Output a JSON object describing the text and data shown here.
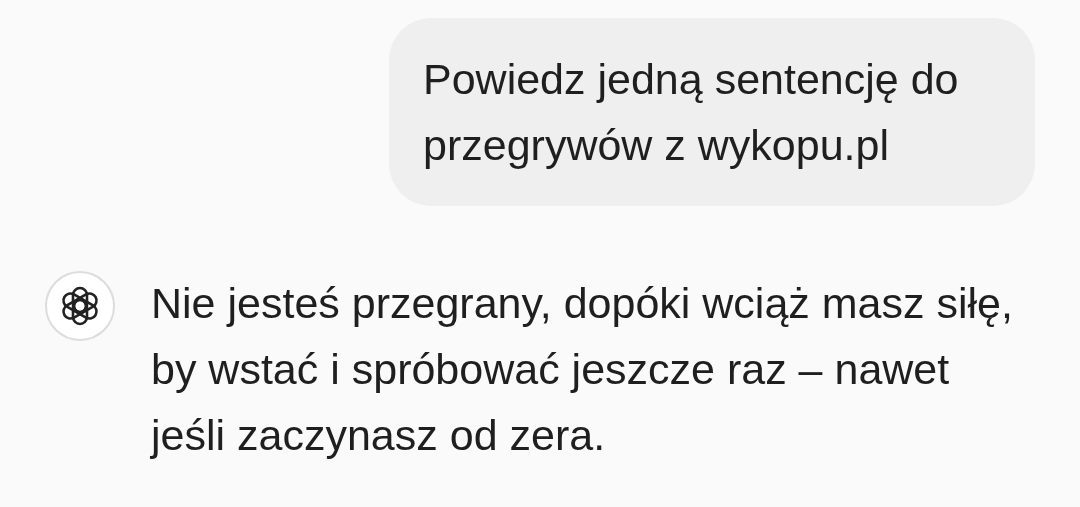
{
  "messages": [
    {
      "kind": "user",
      "text": "Powiedz jedną sentencję do przegrywów z wykopu.pl"
    },
    {
      "kind": "assistant",
      "text": "Nie jesteś przegrany, dopóki wciąż masz siłę, by wstać i spróbować jeszcze raz – nawet jeśli zaczynasz od zera."
    }
  ]
}
